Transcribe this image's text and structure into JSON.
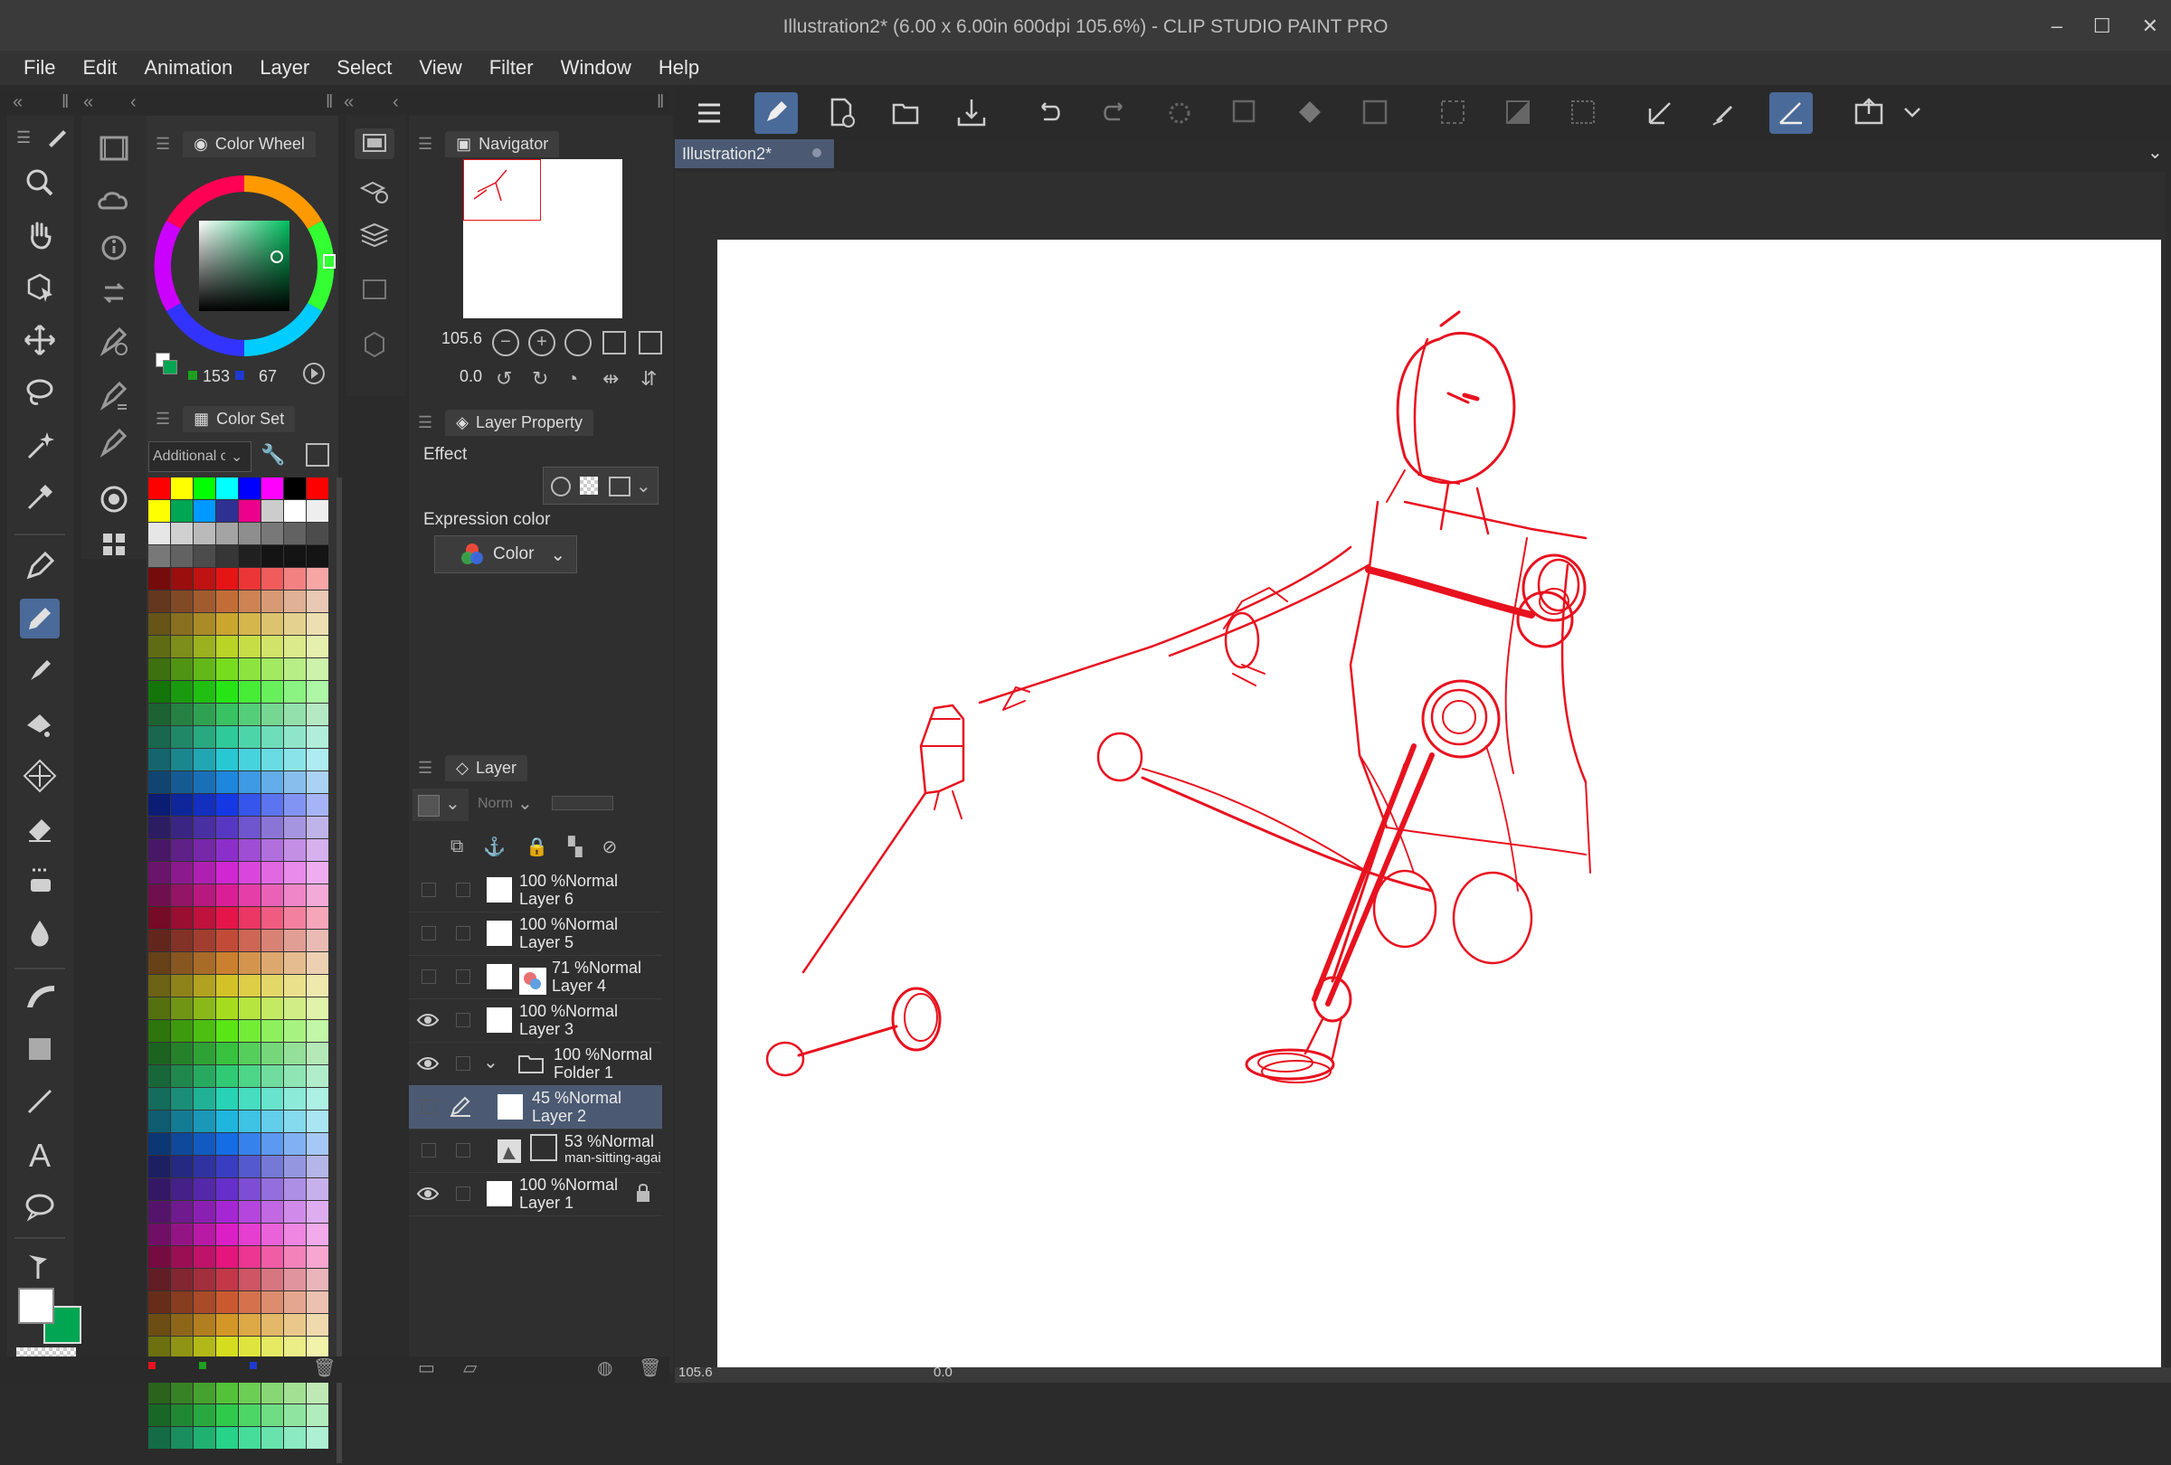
{
  "window": {
    "title": "Illustration2* (6.00 x 6.00in 600dpi 105.6%)  - CLIP STUDIO PAINT PRO",
    "controls": [
      "–",
      "☐",
      "✕"
    ]
  },
  "menu": [
    "File",
    "Edit",
    "Animation",
    "Layer",
    "Select",
    "View",
    "Filter",
    "Window",
    "Help"
  ],
  "color_wheel": {
    "tab_label": "Color Wheel",
    "value_g": "153",
    "value_b": "67",
    "accent": "#00a651"
  },
  "color_set": {
    "tab_label": "Color Set",
    "dropdown": "Additional c"
  },
  "navigator": {
    "tab_label": "Navigator",
    "zoom": "105.6",
    "rotation": "0.0"
  },
  "layer_property": {
    "tab_label": "Layer Property",
    "effect_label": "Effect",
    "expression_label": "Expression color",
    "expression_value": "Color"
  },
  "layer_panel": {
    "tab_label": "Layer",
    "blend_mode": "Norm",
    "layers": [
      {
        "opacity": "100 %Normal",
        "name": "Layer 6"
      },
      {
        "opacity": "100 %Normal",
        "name": "Layer 5"
      },
      {
        "opacity": "71 %Normal",
        "name": "Layer 4"
      },
      {
        "opacity": "100 %Normal",
        "name": "Layer 3"
      },
      {
        "opacity": "100 %Normal",
        "name": "Folder 1"
      },
      {
        "opacity": "45 %Normal",
        "name": "Layer 2"
      },
      {
        "opacity": "53 %Normal",
        "name": "man-sitting-agai"
      },
      {
        "opacity": "100 %Normal",
        "name": "Layer 1"
      }
    ]
  },
  "document_tab": "Illustration2*",
  "status": {
    "zoom": "105.6",
    "angle": "0.0"
  },
  "colors": {
    "sketch_red": "#e8121f",
    "selection_blue": "#4a6a99",
    "main_color": "#ffffff",
    "sub_color": "#00a651"
  }
}
